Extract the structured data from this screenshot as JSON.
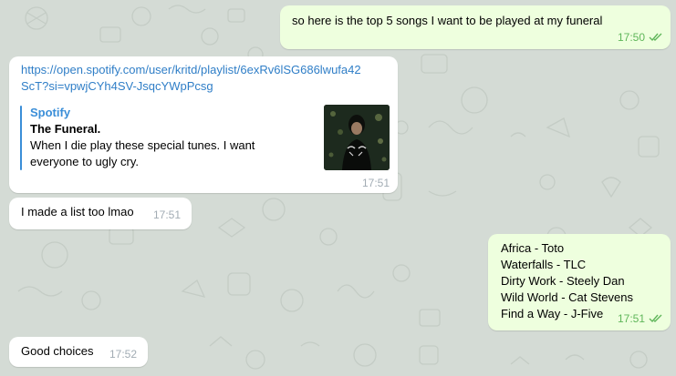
{
  "colors": {
    "chat_background": "#d4dbd5",
    "incoming_bubble": "#ffffff",
    "outgoing_bubble": "#eeffde",
    "outgoing_meta": "#5fb65a",
    "incoming_meta": "#a2acb4",
    "link": "#2f7ec7",
    "preview_accent": "#3a8ed8"
  },
  "messages": [
    {
      "direction": "outgoing",
      "text": "so here is the top 5 songs I want to be played at my funeral",
      "time": "17:50",
      "status_icon": "double-check-icon"
    },
    {
      "direction": "incoming",
      "link_line1": "https://open.spotify.com/user/kritd/playlist/6exRv6lSG686lwufa42",
      "link_line2": "ScT?si=vpwjCYh4SV-JsqcYWpPcsg",
      "preview": {
        "site_name": "Spotify",
        "title": "The Funeral.",
        "description_line1": "When I die play these special tunes. I want",
        "description_line2": "everyone to ugly cry.",
        "thumbnail_icon": "playlist-cover-photo"
      },
      "time": "17:51"
    },
    {
      "direction": "incoming",
      "text": "I made a list too lmao",
      "time": "17:51"
    },
    {
      "direction": "outgoing",
      "lines": [
        "Africa - Toto",
        "Waterfalls - TLC",
        "Dirty Work - Steely Dan",
        "Wild World - Cat Stevens",
        "Find a Way - J-Five"
      ],
      "time": "17:51",
      "status_icon": "double-check-icon"
    },
    {
      "direction": "incoming",
      "text": "Good choices",
      "time": "17:52"
    }
  ]
}
